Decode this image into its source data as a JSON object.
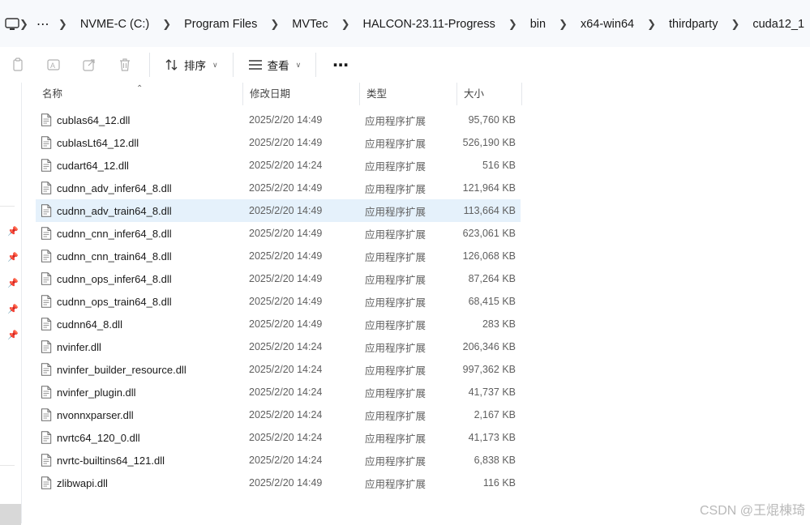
{
  "breadcrumbs": {
    "overflow": "⋯",
    "items": [
      "NVME-C (C:)",
      "Program Files",
      "MVTec",
      "HALCON-23.11-Progress",
      "bin",
      "x64-win64",
      "thirdparty",
      "cuda12_1"
    ]
  },
  "toolbar": {
    "sort_label": "排序",
    "view_label": "查看",
    "more_label": "⋯"
  },
  "columns": {
    "name": "名称",
    "date": "修改日期",
    "type": "类型",
    "size": "大小"
  },
  "files": [
    {
      "name": "cublas64_12.dll",
      "date": "2025/2/20 14:49",
      "type": "应用程序扩展",
      "size": "95,760 KB"
    },
    {
      "name": "cublasLt64_12.dll",
      "date": "2025/2/20 14:49",
      "type": "应用程序扩展",
      "size": "526,190 KB"
    },
    {
      "name": "cudart64_12.dll",
      "date": "2025/2/20 14:24",
      "type": "应用程序扩展",
      "size": "516 KB"
    },
    {
      "name": "cudnn_adv_infer64_8.dll",
      "date": "2025/2/20 14:49",
      "type": "应用程序扩展",
      "size": "121,964 KB"
    },
    {
      "name": "cudnn_adv_train64_8.dll",
      "date": "2025/2/20 14:49",
      "type": "应用程序扩展",
      "size": "113,664 KB",
      "selected": true
    },
    {
      "name": "cudnn_cnn_infer64_8.dll",
      "date": "2025/2/20 14:49",
      "type": "应用程序扩展",
      "size": "623,061 KB"
    },
    {
      "name": "cudnn_cnn_train64_8.dll",
      "date": "2025/2/20 14:49",
      "type": "应用程序扩展",
      "size": "126,068 KB"
    },
    {
      "name": "cudnn_ops_infer64_8.dll",
      "date": "2025/2/20 14:49",
      "type": "应用程序扩展",
      "size": "87,264 KB"
    },
    {
      "name": "cudnn_ops_train64_8.dll",
      "date": "2025/2/20 14:49",
      "type": "应用程序扩展",
      "size": "68,415 KB"
    },
    {
      "name": "cudnn64_8.dll",
      "date": "2025/2/20 14:49",
      "type": "应用程序扩展",
      "size": "283 KB"
    },
    {
      "name": "nvinfer.dll",
      "date": "2025/2/20 14:24",
      "type": "应用程序扩展",
      "size": "206,346 KB"
    },
    {
      "name": "nvinfer_builder_resource.dll",
      "date": "2025/2/20 14:24",
      "type": "应用程序扩展",
      "size": "997,362 KB"
    },
    {
      "name": "nvinfer_plugin.dll",
      "date": "2025/2/20 14:24",
      "type": "应用程序扩展",
      "size": "41,737 KB"
    },
    {
      "name": "nvonnxparser.dll",
      "date": "2025/2/20 14:24",
      "type": "应用程序扩展",
      "size": "2,167 KB"
    },
    {
      "name": "nvrtc64_120_0.dll",
      "date": "2025/2/20 14:24",
      "type": "应用程序扩展",
      "size": "41,173 KB"
    },
    {
      "name": "nvrtc-builtins64_121.dll",
      "date": "2025/2/20 14:24",
      "type": "应用程序扩展",
      "size": "6,838 KB"
    },
    {
      "name": "zlibwapi.dll",
      "date": "2025/2/20 14:49",
      "type": "应用程序扩展",
      "size": "116 KB"
    }
  ],
  "watermark": "CSDN @王焜棟琦",
  "colors": {
    "selected_row": "#e5f1fb",
    "secondary_text": "#5f5f5f"
  }
}
